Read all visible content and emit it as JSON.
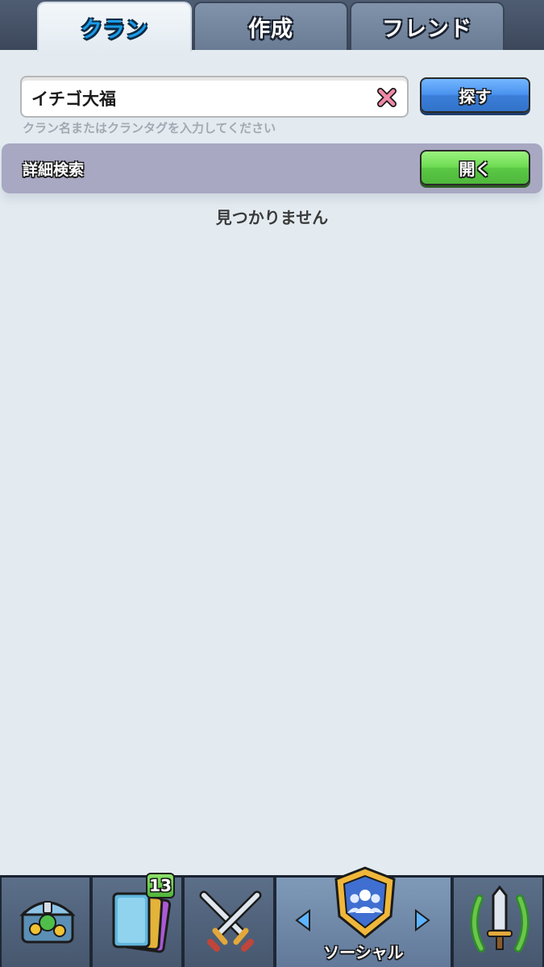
{
  "tabs": [
    {
      "label": "クラン",
      "active": true
    },
    {
      "label": "作成",
      "active": false
    },
    {
      "label": "フレンド",
      "active": false
    }
  ],
  "search": {
    "value": "イチゴ大福",
    "hint": "クラン名またはクランタグを入力してください",
    "button_label": "探す"
  },
  "advanced_search": {
    "label": "詳細検索",
    "button_label": "開く"
  },
  "results": {
    "empty_text": "見つかりません"
  },
  "bottom_nav": {
    "cards_badge": "13",
    "social_label": "ソーシャル",
    "items": [
      "shop-chest-icon",
      "cards-icon",
      "crossed-swords-icon",
      "social-shield-icon",
      "laurel-sword-icon"
    ]
  },
  "colors": {
    "background": "#e3ebf1",
    "active_tab_text": "#1a9ce8",
    "search_button": "#4a92ef",
    "open_button": "#6ddb52",
    "advanced_bar": "#a8a8c2"
  }
}
